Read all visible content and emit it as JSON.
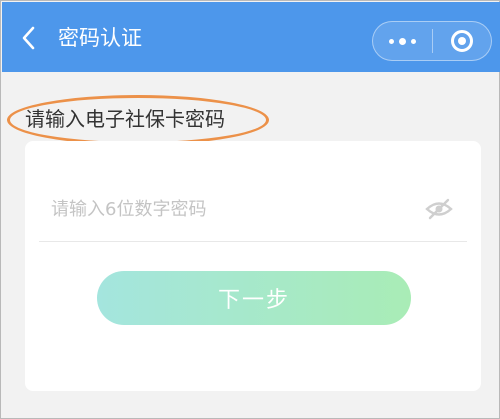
{
  "navbar": {
    "title": "密码认证",
    "back_icon": "chevron-left-icon",
    "menu_icon": "more-dots-icon",
    "close_icon": "target-circle-icon",
    "background_color": "#4d97eb"
  },
  "form": {
    "label": "请输入电子社保卡密码",
    "password": {
      "value": "",
      "placeholder": "请输入6位数字密码",
      "visibility_icon": "eye-hidden-icon"
    },
    "next_button": {
      "label": "下一步",
      "gradient": [
        "#a4e5de",
        "#a9ecb6"
      ]
    }
  },
  "annotation": {
    "highlight_color": "#ec9149"
  }
}
